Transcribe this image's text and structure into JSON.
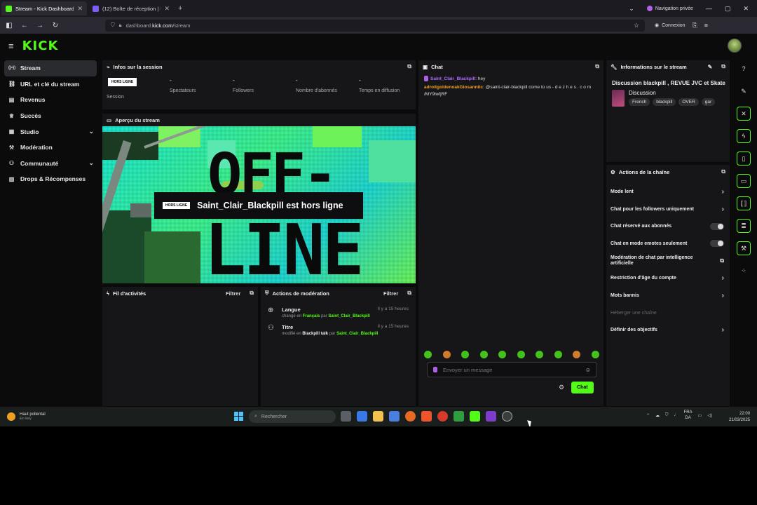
{
  "browser": {
    "tabs": [
      {
        "title": "Stream - Kick Dashboard",
        "active": true
      },
      {
        "title": "(12) Boîte de réception | laboX",
        "active": false
      }
    ],
    "private_label": "Navigation privée",
    "url_prefix": "dashboard.",
    "url_host": "kick.com",
    "url_path": "/stream",
    "connect_label": "Connexion"
  },
  "brand": {
    "logo": "KICK",
    "accent": "#53fc18"
  },
  "sidebar": {
    "items": [
      {
        "label": "Stream",
        "icon": "broadcast-icon",
        "active": true
      },
      {
        "label": "URL et clé du stream",
        "icon": "link-icon"
      },
      {
        "label": "Revenus",
        "icon": "money-icon"
      },
      {
        "label": "Succès",
        "icon": "trophy-icon"
      },
      {
        "label": "Studio",
        "icon": "studio-icon",
        "expand": true
      },
      {
        "label": "Modération",
        "icon": "wrench-icon"
      },
      {
        "label": "Communauté",
        "icon": "people-icon",
        "expand": true
      },
      {
        "label": "Drops & Récompenses",
        "icon": "gift-icon"
      }
    ]
  },
  "session": {
    "title": "Infos sur la session",
    "offline_tag": "HORS LIGNE",
    "tag_label": "Session",
    "columns": [
      {
        "value": "-",
        "label": "Spectateurs"
      },
      {
        "value": "-",
        "label": "Followers"
      },
      {
        "value": "-",
        "label": "Nombre d'abonnés"
      },
      {
        "value": "-",
        "label": "Temps en diffusion"
      }
    ]
  },
  "preview": {
    "title": "Aperçu du stream",
    "offline_line1": "OFF-",
    "offline_line2": "LINE",
    "banner_tag": "HORS LIGNE",
    "banner_text": "Saint_Clair_Blackpill est hors ligne"
  },
  "activity": {
    "title": "Fil d'activités",
    "filter": "Filtrer"
  },
  "moderation": {
    "title": "Actions de modération",
    "filter": "Filtrer",
    "rows": [
      {
        "icon": "globe-icon",
        "title": "Langue",
        "time": "Il y a 15 heures",
        "prefix": "changé en",
        "value": "Français",
        "mid": "par",
        "user": "Saint_Clair_Blackpill"
      },
      {
        "icon": "users-icon",
        "title": "Titre",
        "time": "Il y a 15 heures",
        "prefix": "modifié en",
        "value": "Blackpill talk",
        "mid": "par",
        "user": "Saint_Clair_Blackpill"
      }
    ]
  },
  "chat": {
    "title": "Chat",
    "messages": [
      {
        "user": "Saint_Clair_Blackpill",
        "text": ": hey"
      },
      {
        "user": "adroitgoldenoakGiosannitc",
        "text": ": @saint-clair-blackpill come to us - d e z h e s . c o m /MY9lwfjRF"
      }
    ],
    "input_placeholder": "Envoyer un message",
    "send_label": "Chat"
  },
  "stream_info": {
    "title": "Informations sur le stream",
    "stream_title": "Discussion blackpill , REVUE JVC et Skate",
    "category": "Discussion",
    "tags": [
      "French",
      "blackpill",
      "OVER",
      "gar"
    ]
  },
  "channel_actions": {
    "title": "Actions de la chaîne",
    "rows": [
      {
        "label": "Mode lent",
        "type": "chevron"
      },
      {
        "label": "Chat pour les followers uniquement",
        "type": "chevron"
      },
      {
        "label": "Chat réservé aux abonnés",
        "type": "toggle"
      },
      {
        "label": "Chat en mode emotes seulement",
        "type": "toggle"
      },
      {
        "label": "Modération de chat par intelligence artificielle",
        "type": "external"
      },
      {
        "label": "Restriction d'âge du compte",
        "type": "chevron"
      },
      {
        "label": "Mots bannis",
        "type": "chevron"
      },
      {
        "label": "Héberger une chaîne",
        "type": "disabled"
      },
      {
        "label": "Définir des objectifs",
        "type": "chevron"
      }
    ]
  },
  "taskbar": {
    "weather_title": "Haut pollental",
    "weather_sub": "En key",
    "search_placeholder": "Rechercher",
    "lang_top": "FRA",
    "lang_bottom": "DA",
    "time": "22:00",
    "date": "21/03/2025"
  }
}
